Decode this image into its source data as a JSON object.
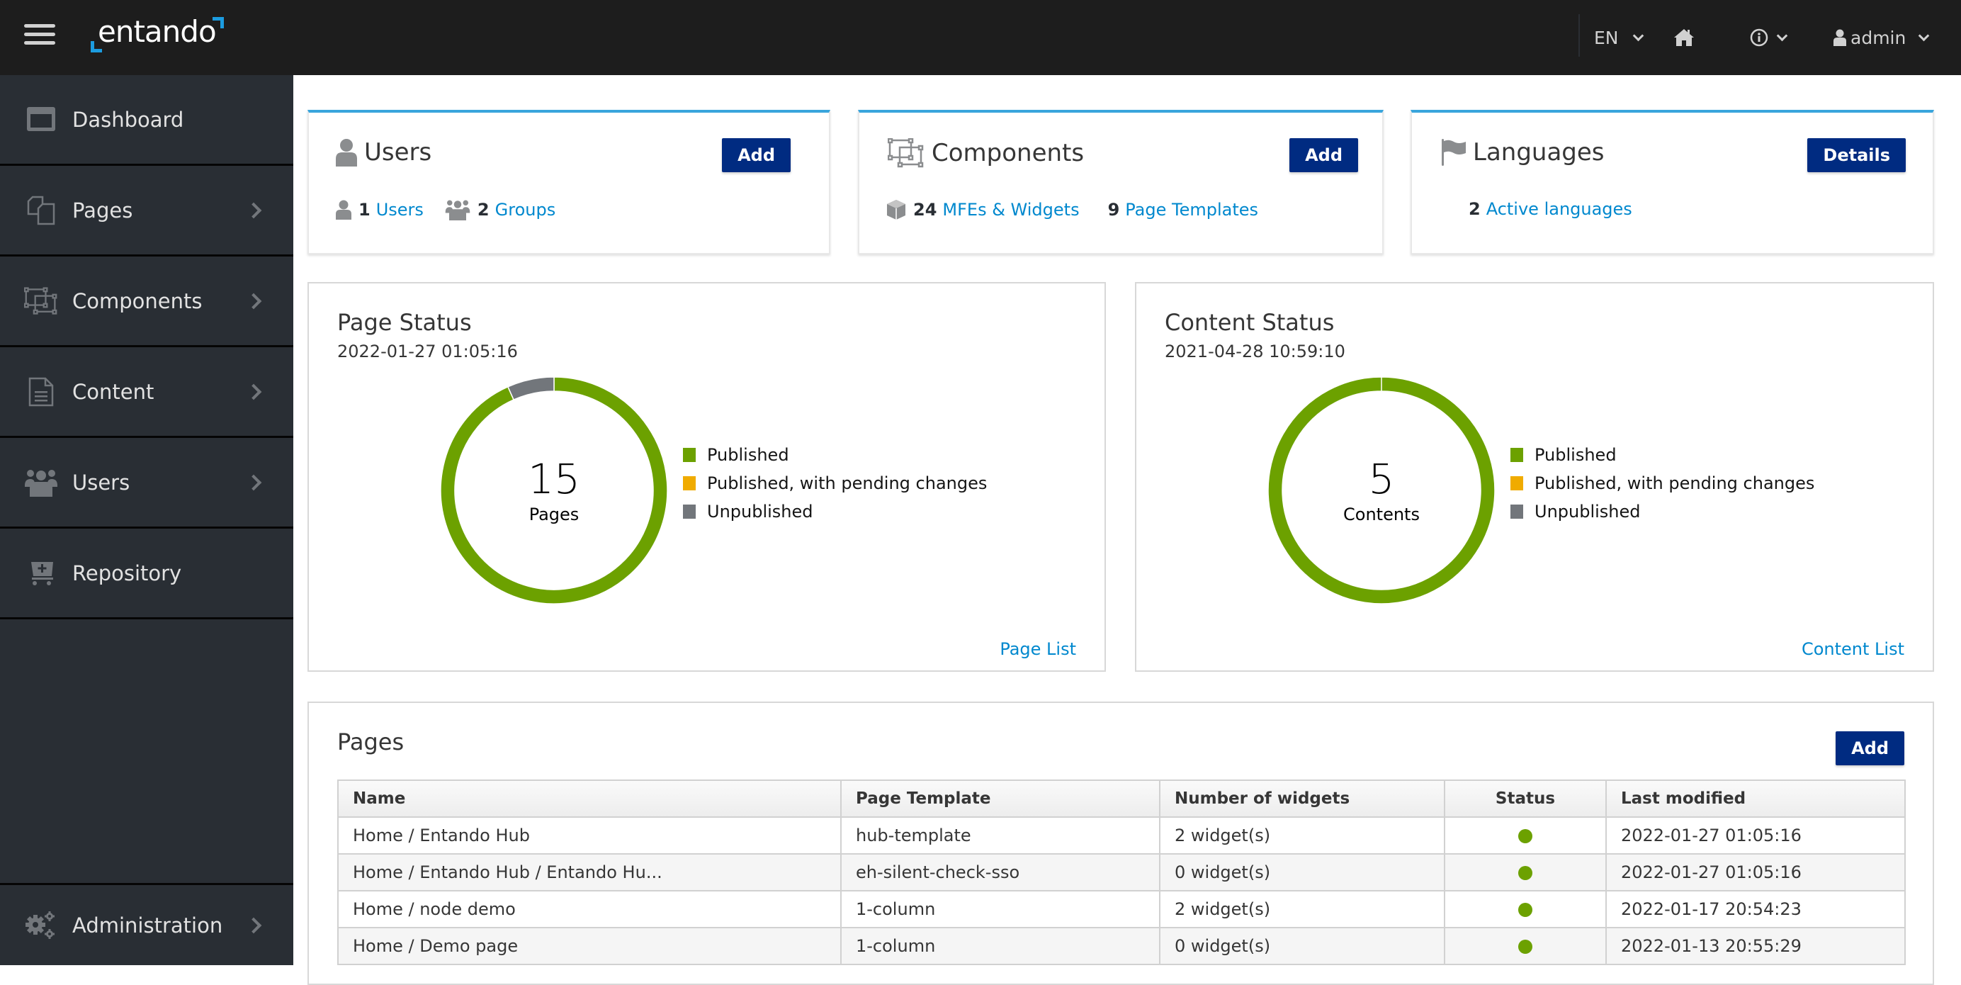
{
  "header": {
    "logo_text": "entando",
    "language": "EN",
    "user": "admin",
    "icons": [
      "hamburger-menu-icon",
      "home-icon",
      "info-icon",
      "user-icon"
    ]
  },
  "sidebar": {
    "items": [
      {
        "label": "Dashboard",
        "icon": "dashboard-icon",
        "expandable": false
      },
      {
        "label": "Pages",
        "icon": "pages-icon",
        "expandable": true
      },
      {
        "label": "Components",
        "icon": "components-icon",
        "expandable": true
      },
      {
        "label": "Content",
        "icon": "content-icon",
        "expandable": true
      },
      {
        "label": "Users",
        "icon": "users-icon",
        "expandable": true
      },
      {
        "label": "Repository",
        "icon": "repository-icon",
        "expandable": false
      }
    ],
    "footer_item": {
      "label": "Administration",
      "icon": "gears-icon",
      "expandable": true
    }
  },
  "cards": {
    "users": {
      "title": "Users",
      "button": "Add",
      "users_count": "1",
      "users_link": "Users",
      "groups_count": "2",
      "groups_link": "Groups"
    },
    "components": {
      "title": "Components",
      "button": "Add",
      "widgets_count": "24",
      "widgets_link": "MFEs & Widgets",
      "templates_count": "9",
      "templates_link": "Page Templates"
    },
    "languages": {
      "title": "Languages",
      "button": "Details",
      "active_count": "2",
      "active_link": "Active languages"
    }
  },
  "page_status": {
    "title": "Page Status",
    "date": "2022-01-27 01:05:16",
    "total": "15",
    "unit": "Pages",
    "link": "Page List"
  },
  "content_status": {
    "title": "Content Status",
    "date": "2021-04-28 10:59:10",
    "total": "5",
    "unit": "Contents",
    "link": "Content List"
  },
  "legend": {
    "published": "Published",
    "pending": "Published, with pending changes",
    "unpublished": "Unpublished"
  },
  "colors": {
    "published": "#6ca100",
    "pending": "#f0ab00",
    "unpublished": "#72767b",
    "primary_button": "#002b81",
    "link": "#0088ce",
    "card_accent": "#39a5dc"
  },
  "chart_data": [
    {
      "type": "pie",
      "title": "Page Status",
      "categories": [
        "Published",
        "Published, with pending changes",
        "Unpublished"
      ],
      "values": [
        14,
        0,
        1
      ],
      "center_label": "15 Pages",
      "legend": "right"
    },
    {
      "type": "pie",
      "title": "Content Status",
      "categories": [
        "Published",
        "Published, with pending changes",
        "Unpublished"
      ],
      "values": [
        5,
        0,
        0
      ],
      "center_label": "5 Contents",
      "legend": "right"
    }
  ],
  "pages_table": {
    "title": "Pages",
    "button": "Add",
    "columns": [
      "Name",
      "Page Template",
      "Number of widgets",
      "Status",
      "Last modified"
    ],
    "rows": [
      {
        "name": "Home / Entando Hub",
        "template": "hub-template",
        "widgets": "2 widget(s)",
        "status": "published",
        "modified": "2022-01-27 01:05:16"
      },
      {
        "name": "Home / Entando Hub / Entando Hu...",
        "template": "eh-silent-check-sso",
        "widgets": "0 widget(s)",
        "status": "published",
        "modified": "2022-01-27 01:05:16"
      },
      {
        "name": "Home / node demo",
        "template": "1-column",
        "widgets": "2 widget(s)",
        "status": "published",
        "modified": "2022-01-17 20:54:23"
      },
      {
        "name": "Home / Demo page",
        "template": "1-column",
        "widgets": "0 widget(s)",
        "status": "published",
        "modified": "2022-01-13 20:55:29"
      }
    ]
  }
}
